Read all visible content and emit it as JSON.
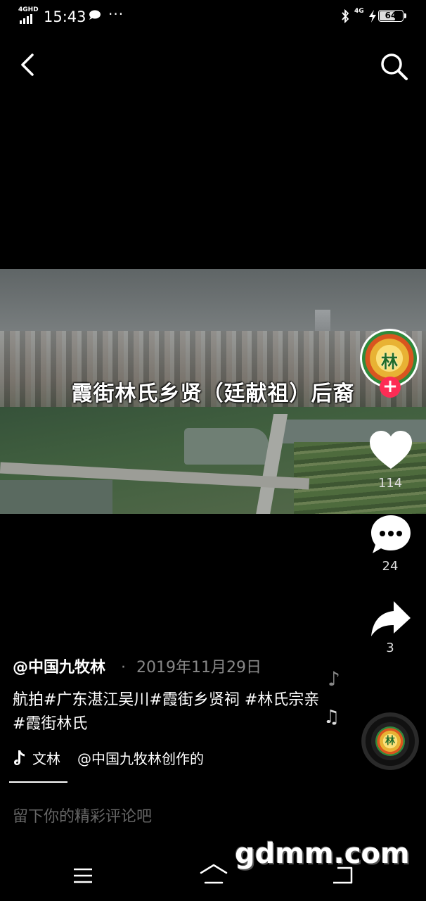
{
  "status_bar": {
    "network_type": "4GHD",
    "time": "15:43",
    "more": "···",
    "cellular": "4G",
    "battery": "64"
  },
  "top_nav": {
    "back_icon": "chevron-left-icon",
    "search_icon": "search-icon"
  },
  "video": {
    "caption": "霞街林氏乡贤（廷献祖）后裔"
  },
  "creator": {
    "avatar_label": "林",
    "follow_label": "+"
  },
  "actions": {
    "likes": "114",
    "comments": "24",
    "shares": "3"
  },
  "post": {
    "author": "@中国九牧林",
    "separator": "·",
    "date": "2019年11月29日",
    "description": "航拍#广东湛江吴川#霞街乡贤祠 #林氏宗亲#霞街林氏"
  },
  "music": {
    "icon": "tiktok-icon",
    "title": "文林",
    "by": "@中国九牧林创作的",
    "disc_label": "林"
  },
  "comment_input": {
    "placeholder": "留下你的精彩评论吧"
  },
  "watermark": "gdmm.com",
  "nav_bar": {
    "menu_icon": "menu-icon",
    "home_icon": "home-icon",
    "back_icon": "back-icon"
  }
}
